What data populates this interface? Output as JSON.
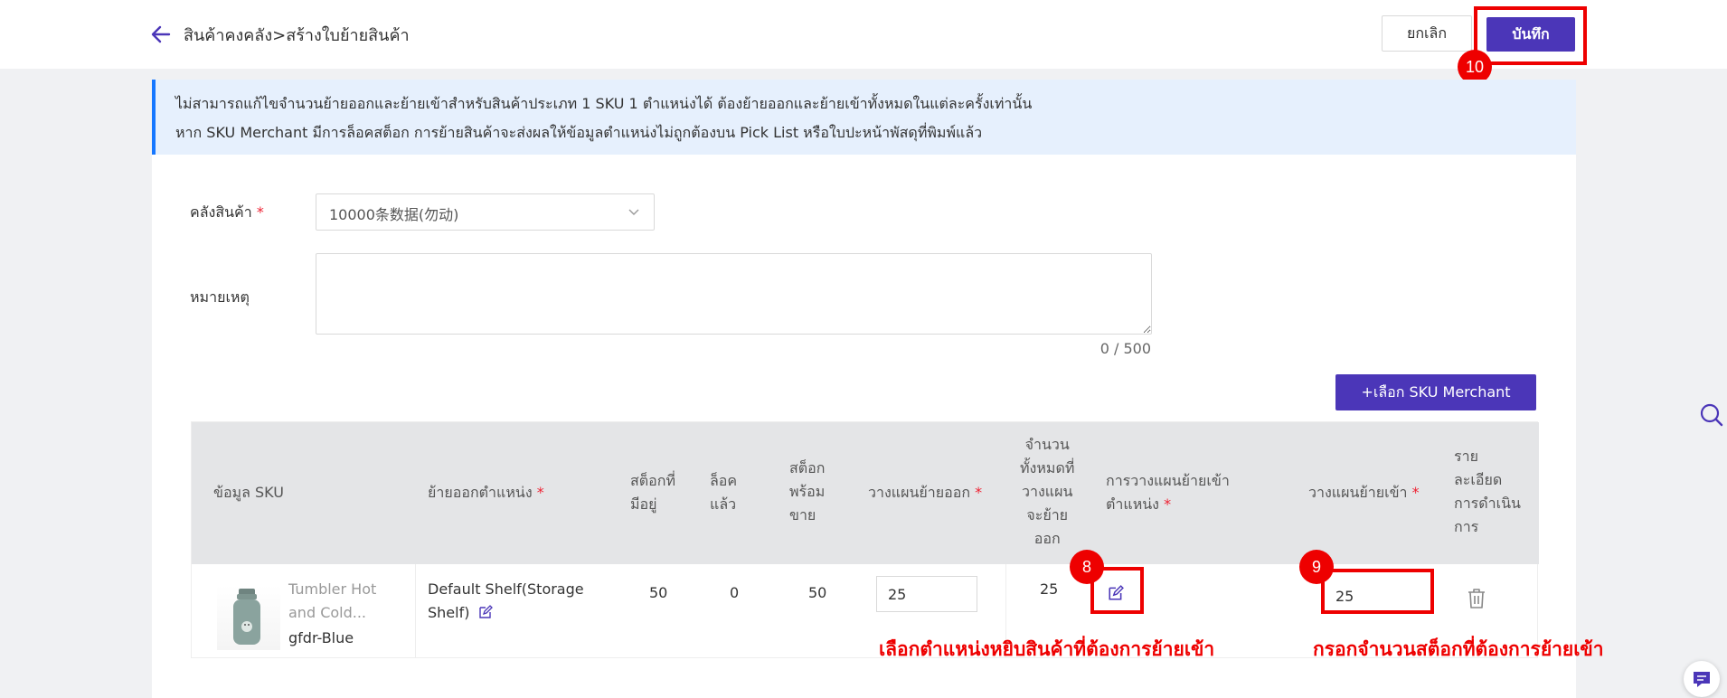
{
  "header": {
    "breadcrumb": "สินค้าคงคลัง>สร้างใบย้ายสินค้า",
    "cancel_label": "ยกเลิก",
    "save_label": "บันทึก"
  },
  "steps": {
    "save": "10",
    "location": "8",
    "quantity": "9"
  },
  "notice": {
    "line1": "ไม่สามารถแก้ไขจำนวนย้ายออกและย้ายเข้าสำหรับสินค้าประเภท 1 SKU 1 ตำแหน่งได้ ต้องย้ายออกและย้ายเข้าทั้งหมดในแต่ละครั้งเท่านั้น",
    "line2": "หาก SKU Merchant มีการล็อคสต็อก การย้ายสินค้าจะส่งผลให้ข้อมูลตำแหน่งไม่ถูกต้องบน Pick List หรือใบปะหน้าพัสดุที่พิมพ์แล้ว"
  },
  "form": {
    "warehouse_label": "คลังสินค้า",
    "warehouse_value": "10000条数据(勿动)",
    "remark_label": "หมายเหตุ",
    "remark_counter": "0 / 500",
    "select_sku_label": "+เลือก SKU Merchant"
  },
  "table": {
    "headers": {
      "sku_info": "ข้อมูล SKU",
      "move_out_location": "ย้ายออกตำแหน่ง",
      "on_hand": [
        "สต็อกที่",
        "มีอยู่"
      ],
      "locked": [
        "ล็อค",
        "แล้ว"
      ],
      "available": [
        "สต็อก",
        "พร้อม",
        "ขาย"
      ],
      "plan_out": "วางแผนย้ายออก",
      "total_plan_out": [
        "จำนวน",
        "ทั้งหมดที่",
        "วางแผน",
        "จะย้าย",
        "ออก"
      ],
      "plan_in_location": [
        "การวางแผนย้ายเข้า",
        "ตำแหน่ง"
      ],
      "plan_in": "วางแผนย้ายเข้า",
      "actions": [
        "ราย",
        "ละเอียด",
        "การดำเนิน",
        "การ"
      ]
    },
    "row": {
      "product_name_1": "Tumbler Hot",
      "product_name_2": "and Cold...",
      "variant": "gfdr-Blue",
      "location_1": "Default Shelf(Storage",
      "location_2": "Shelf)",
      "on_hand": "50",
      "locked": "0",
      "available": "50",
      "plan_out": "25",
      "total_plan_out": "25",
      "plan_in": "25"
    }
  },
  "annotations": {
    "location_hint": "เลือกตำแหน่งหยิบสินค้าที่ต้องการย้ายเข้า",
    "quantity_hint": "กรอกจำนวนสต็อกที่ต้องการย้ายเข้า"
  },
  "colors": {
    "primary": "#4b36b8",
    "highlight": "#e00000",
    "notice_bg": "#e6f0fd"
  }
}
